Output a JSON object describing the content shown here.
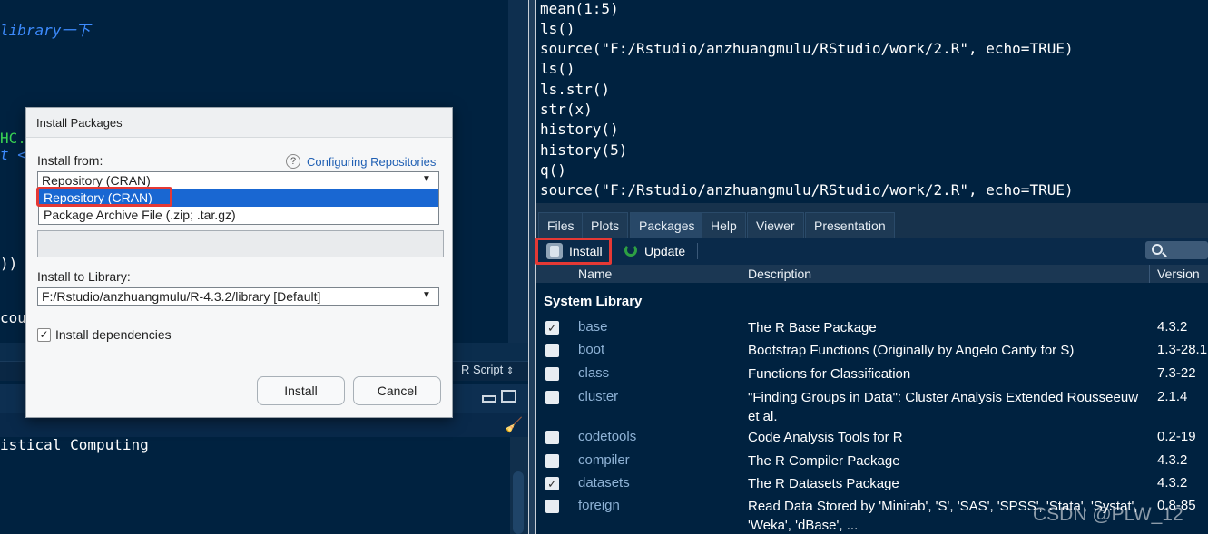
{
  "left_editor": {
    "lines": [
      {
        "text": "library一下",
        "color": "#3d8cff",
        "italic": true
      },
      {
        "text": "HC.",
        "color": "#39d353",
        "italic": false
      },
      {
        "text": "t <",
        "color": "#3d8cff",
        "italic": true
      },
      {
        "text": "))",
        "color": "#ffffff",
        "italic": false
      },
      {
        "text": "cou",
        "color": "#ffffff",
        "italic": false
      }
    ],
    "file_type": "R Script"
  },
  "left_console": {
    "text": "istical Computing"
  },
  "right_console": {
    "lines": [
      "mean(1:5)",
      "ls()",
      "source(\"F:/Rstudio/anzhuangmulu/RStudio/work/2.R\", echo=TRUE)",
      "ls()",
      "ls.str()",
      "str(x)",
      "history()",
      "history(5)",
      "q()",
      "source(\"F:/Rstudio/anzhuangmulu/RStudio/work/2.R\", echo=TRUE)"
    ]
  },
  "tabs": [
    "Files",
    "Plots",
    "Packages",
    "Help",
    "Viewer",
    "Presentation"
  ],
  "active_tab": "Packages",
  "toolbar": {
    "install_label": "Install",
    "update_label": "Update",
    "search_icon": "search-icon"
  },
  "table": {
    "headers": {
      "name": "Name",
      "description": "Description",
      "version": "Version"
    },
    "section": "System Library",
    "rows": [
      {
        "checked": true,
        "name": "base",
        "description": "The R Base Package",
        "version": "4.3.2"
      },
      {
        "checked": false,
        "name": "boot",
        "description": "Bootstrap Functions (Originally by Angelo Canty for S)",
        "version": "1.3-28.1"
      },
      {
        "checked": false,
        "name": "class",
        "description": "Functions for Classification",
        "version": "7.3-22"
      },
      {
        "checked": false,
        "name": "cluster",
        "description": "\"Finding Groups in Data\": Cluster Analysis Extended Rousseeuw et al.",
        "version": "2.1.4"
      },
      {
        "checked": false,
        "name": "codetools",
        "description": "Code Analysis Tools for R",
        "version": "0.2-19"
      },
      {
        "checked": false,
        "name": "compiler",
        "description": "The R Compiler Package",
        "version": "4.3.2"
      },
      {
        "checked": true,
        "name": "datasets",
        "description": "The R Datasets Package",
        "version": "4.3.2"
      },
      {
        "checked": false,
        "name": "foreign",
        "description": "Read Data Stored by 'Minitab', 'S', 'SAS', 'SPSS', 'Stata', 'Systat', 'Weka', 'dBase', ...",
        "version": "0.8-85"
      }
    ]
  },
  "dialog": {
    "title": "Install Packages",
    "install_from_label": "Install from:",
    "help_icon": "?",
    "config_link": "Configuring Repositories",
    "repo_selected": "Repository (CRAN)",
    "repo_options": [
      "Repository (CRAN)",
      "Package Archive File (.zip; .tar.gz)"
    ],
    "install_to_label": "Install to Library:",
    "library_selected": "F:/Rstudio/anzhuangmulu/R-4.3.2/library [Default]",
    "install_deps_label": "Install dependencies",
    "install_deps_checked": true,
    "install_button": "Install",
    "cancel_button": "Cancel"
  },
  "watermark": "CSDN @PLW_12",
  "colors": {
    "background": "#002240",
    "highlight_red": "#e53935",
    "selection_blue": "#1967d2",
    "package_name": "#8fb3d6"
  }
}
